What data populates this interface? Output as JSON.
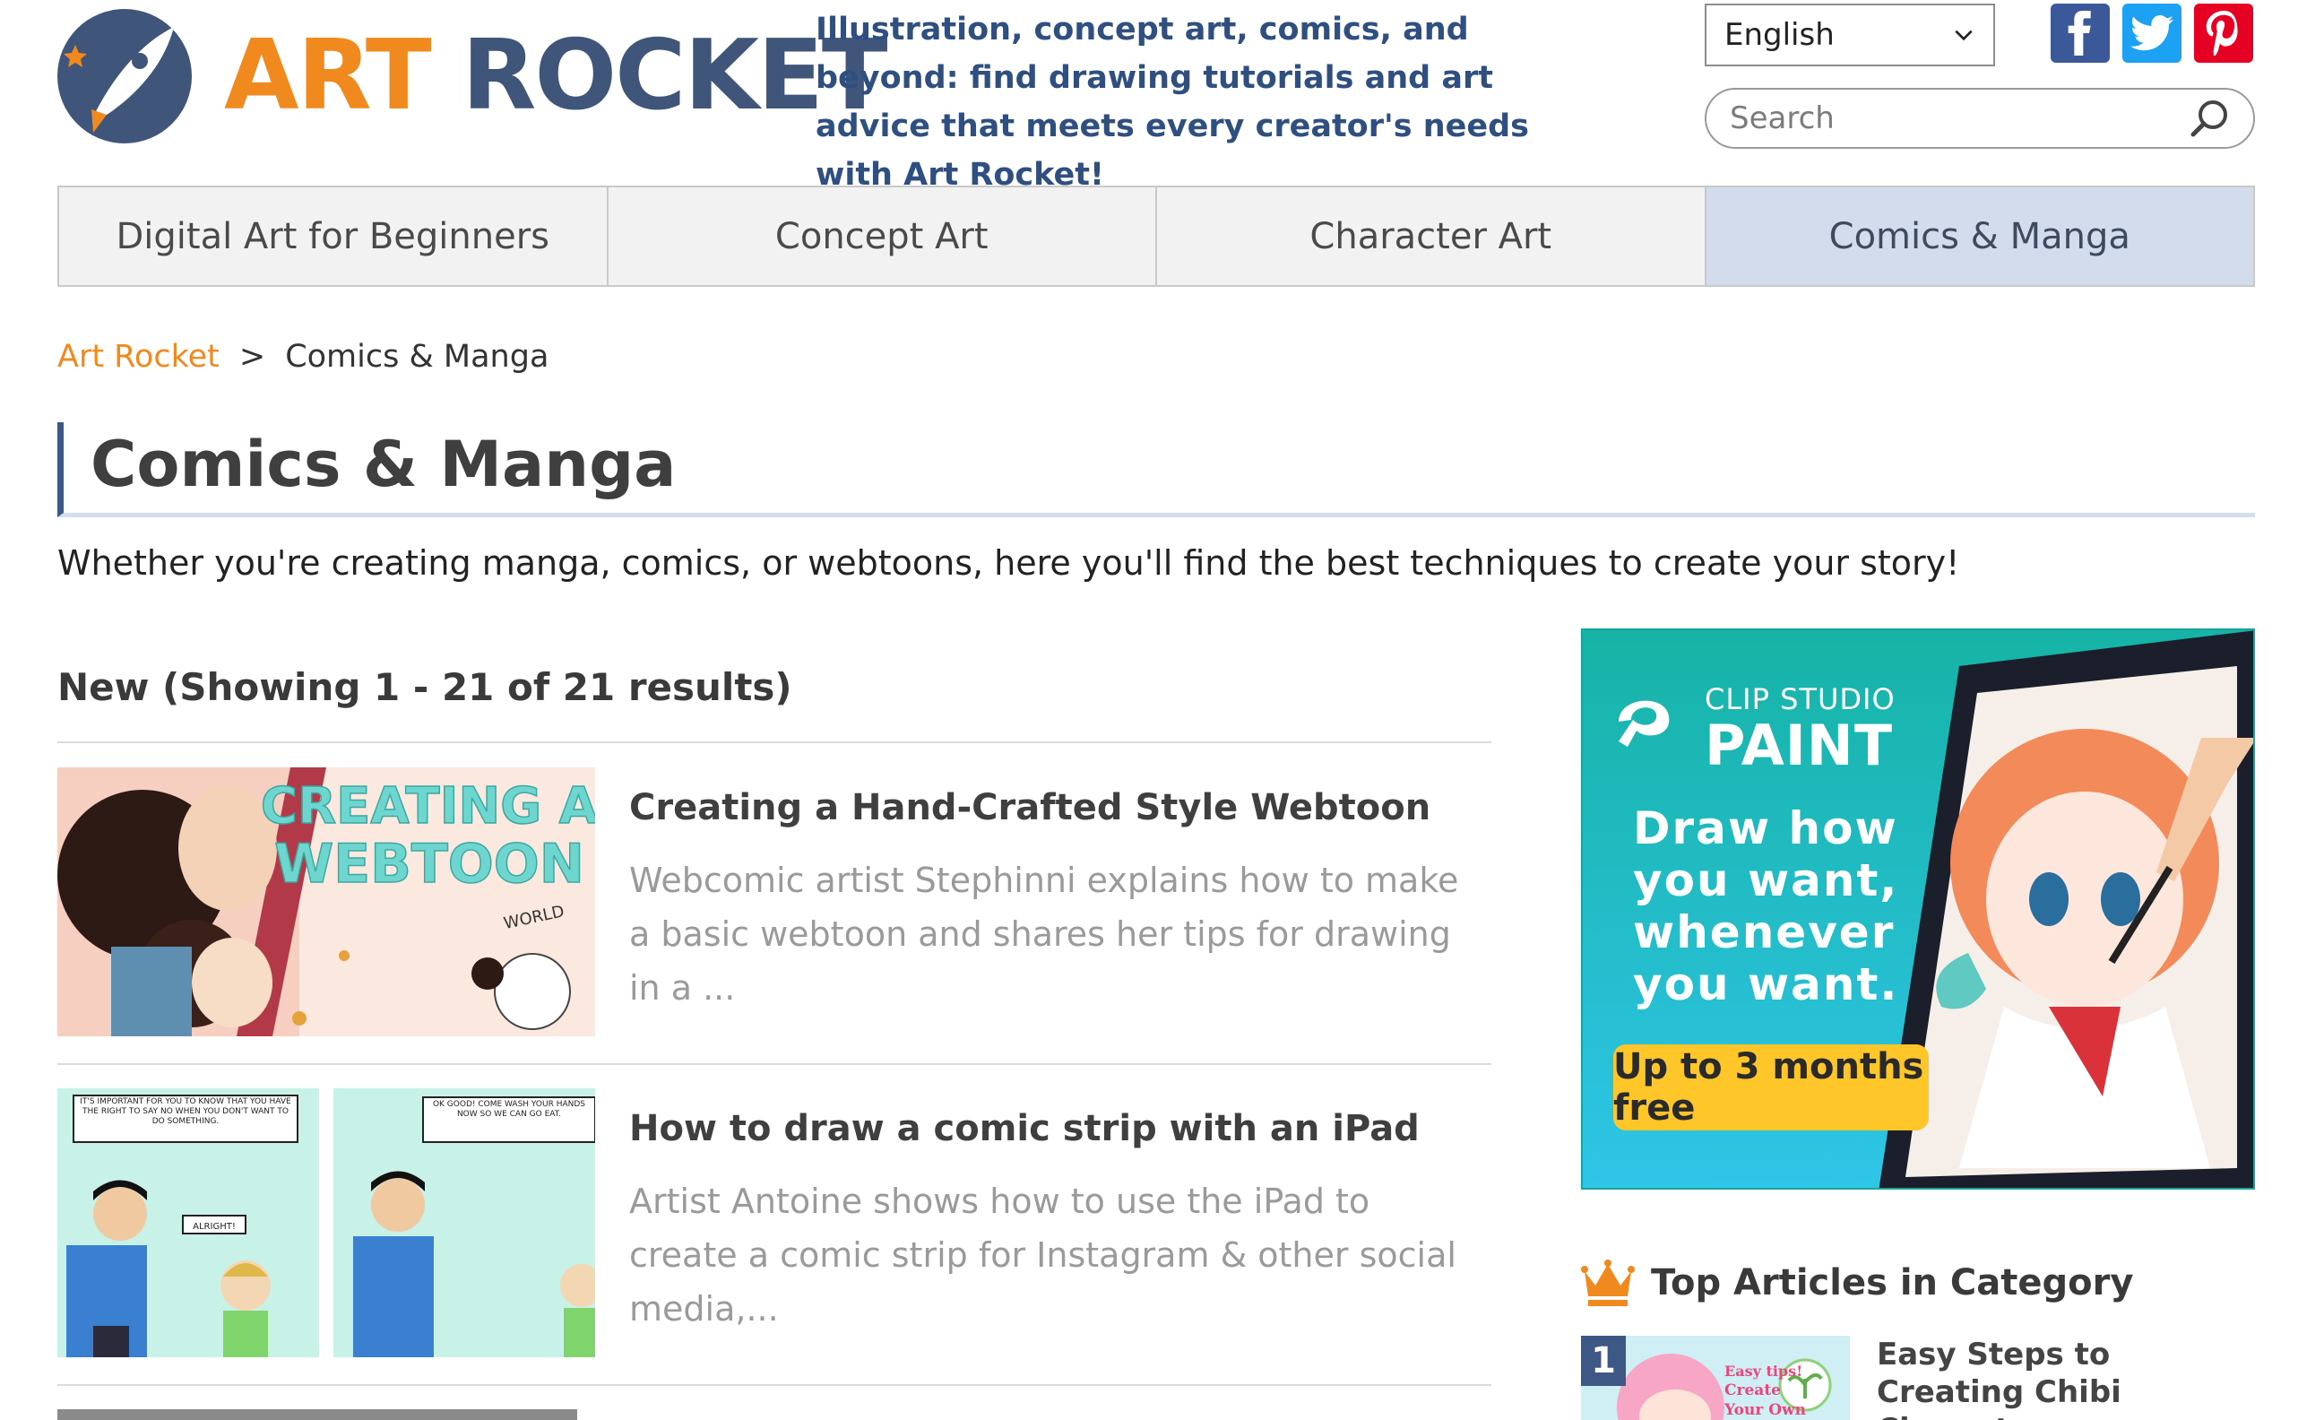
{
  "brand": {
    "word1": "ART",
    "word2": "ROCKET",
    "tagline": "Illustration, concept art, comics, and beyond: find drawing tutorials and art advice that meets every creator's needs with Art Rocket!"
  },
  "language": {
    "selected": "English"
  },
  "search": {
    "placeholder": "Search"
  },
  "social": [
    "facebook-icon",
    "twitter-icon",
    "pinterest-icon"
  ],
  "nav": {
    "tabs": [
      {
        "label": "Digital Art for Beginners",
        "active": false
      },
      {
        "label": "Concept Art",
        "active": false
      },
      {
        "label": "Character Art",
        "active": false
      },
      {
        "label": "Comics & Manga",
        "active": true
      }
    ]
  },
  "breadcrumb": {
    "home": "Art Rocket",
    "separator": ">",
    "current": "Comics & Manga"
  },
  "page": {
    "title": "Comics & Manga",
    "intro": "Whether you're creating manga, comics, or webtoons, here you'll find the best techniques to create your story!",
    "results_heading": "New (Showing 1 - 21 of 21 results)"
  },
  "articles": [
    {
      "title": "Creating a Hand-Crafted Style Webtoon",
      "description": "Webcomic artist Stephinni explains how to make a basic webtoon and shares her tips for drawing in a ...",
      "thumb_text_1": "CREATING A",
      "thumb_text_2": "WEBTOON",
      "thumb_text_3": "WORLD"
    },
    {
      "title": "How to draw a comic strip with an iPad",
      "description": "Artist Antoine shows how to use the iPad to create a comic strip for Instagram & other social media,...",
      "bubble_1": "IT'S IMPORTANT FOR YOU TO KNOW THAT YOU HAVE THE RIGHT TO SAY NO WHEN YOU DON'T WANT TO DO SOMETHING.",
      "bubble_2": "ALRIGHT!",
      "bubble_3": "OK GOOD! COME WASH YOUR HANDS NOW SO WE CAN GO EAT."
    }
  ],
  "ad": {
    "brand_top": "CLIP STUDIO",
    "brand_main": "PAINT",
    "lines": [
      "Draw how",
      "you want,",
      "whenever",
      "you want."
    ],
    "cta": "Up to 3 months free"
  },
  "top_articles": {
    "heading": "Top Articles in Category",
    "items": [
      {
        "rank": "1",
        "title": "Easy Steps to Creating Chibi Characters",
        "thumb_text_1": "Easy tips!",
        "thumb_text_2": "Create",
        "thumb_text_3": "Your Own"
      }
    ]
  },
  "colors": {
    "brand_orange": "#f0891e",
    "brand_navy": "#40557a",
    "tagline_blue": "#2e4f80",
    "active_tab": "#d3dcec",
    "ad_teal": "#1aa29c",
    "cta_yellow": "#ffc62a"
  }
}
